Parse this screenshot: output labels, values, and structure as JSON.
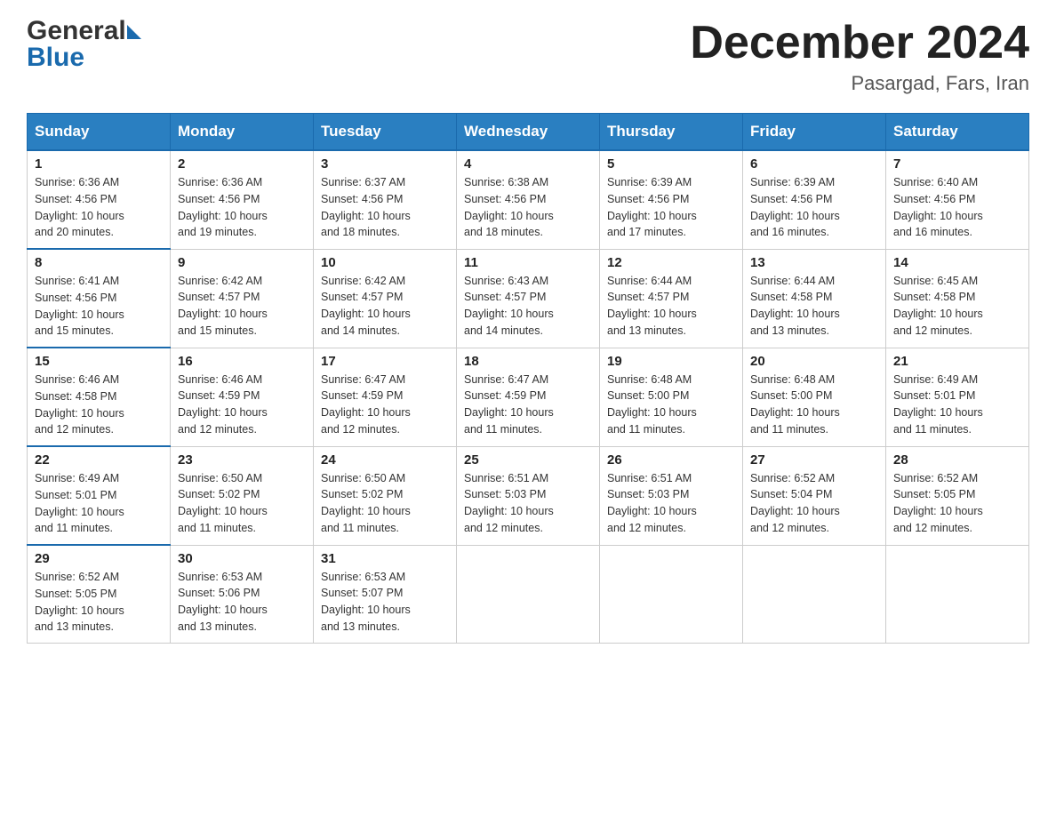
{
  "header": {
    "logo": {
      "general": "General",
      "blue": "Blue"
    },
    "title": "December 2024",
    "location": "Pasargad, Fars, Iran"
  },
  "days_of_week": [
    "Sunday",
    "Monday",
    "Tuesday",
    "Wednesday",
    "Thursday",
    "Friday",
    "Saturday"
  ],
  "weeks": [
    [
      {
        "day": "1",
        "sunrise": "6:36 AM",
        "sunset": "4:56 PM",
        "daylight": "10 hours and 20 minutes."
      },
      {
        "day": "2",
        "sunrise": "6:36 AM",
        "sunset": "4:56 PM",
        "daylight": "10 hours and 19 minutes."
      },
      {
        "day": "3",
        "sunrise": "6:37 AM",
        "sunset": "4:56 PM",
        "daylight": "10 hours and 18 minutes."
      },
      {
        "day": "4",
        "sunrise": "6:38 AM",
        "sunset": "4:56 PM",
        "daylight": "10 hours and 18 minutes."
      },
      {
        "day": "5",
        "sunrise": "6:39 AM",
        "sunset": "4:56 PM",
        "daylight": "10 hours and 17 minutes."
      },
      {
        "day": "6",
        "sunrise": "6:39 AM",
        "sunset": "4:56 PM",
        "daylight": "10 hours and 16 minutes."
      },
      {
        "day": "7",
        "sunrise": "6:40 AM",
        "sunset": "4:56 PM",
        "daylight": "10 hours and 16 minutes."
      }
    ],
    [
      {
        "day": "8",
        "sunrise": "6:41 AM",
        "sunset": "4:56 PM",
        "daylight": "10 hours and 15 minutes."
      },
      {
        "day": "9",
        "sunrise": "6:42 AM",
        "sunset": "4:57 PM",
        "daylight": "10 hours and 15 minutes."
      },
      {
        "day": "10",
        "sunrise": "6:42 AM",
        "sunset": "4:57 PM",
        "daylight": "10 hours and 14 minutes."
      },
      {
        "day": "11",
        "sunrise": "6:43 AM",
        "sunset": "4:57 PM",
        "daylight": "10 hours and 14 minutes."
      },
      {
        "day": "12",
        "sunrise": "6:44 AM",
        "sunset": "4:57 PM",
        "daylight": "10 hours and 13 minutes."
      },
      {
        "day": "13",
        "sunrise": "6:44 AM",
        "sunset": "4:58 PM",
        "daylight": "10 hours and 13 minutes."
      },
      {
        "day": "14",
        "sunrise": "6:45 AM",
        "sunset": "4:58 PM",
        "daylight": "10 hours and 12 minutes."
      }
    ],
    [
      {
        "day": "15",
        "sunrise": "6:46 AM",
        "sunset": "4:58 PM",
        "daylight": "10 hours and 12 minutes."
      },
      {
        "day": "16",
        "sunrise": "6:46 AM",
        "sunset": "4:59 PM",
        "daylight": "10 hours and 12 minutes."
      },
      {
        "day": "17",
        "sunrise": "6:47 AM",
        "sunset": "4:59 PM",
        "daylight": "10 hours and 12 minutes."
      },
      {
        "day": "18",
        "sunrise": "6:47 AM",
        "sunset": "4:59 PM",
        "daylight": "10 hours and 11 minutes."
      },
      {
        "day": "19",
        "sunrise": "6:48 AM",
        "sunset": "5:00 PM",
        "daylight": "10 hours and 11 minutes."
      },
      {
        "day": "20",
        "sunrise": "6:48 AM",
        "sunset": "5:00 PM",
        "daylight": "10 hours and 11 minutes."
      },
      {
        "day": "21",
        "sunrise": "6:49 AM",
        "sunset": "5:01 PM",
        "daylight": "10 hours and 11 minutes."
      }
    ],
    [
      {
        "day": "22",
        "sunrise": "6:49 AM",
        "sunset": "5:01 PM",
        "daylight": "10 hours and 11 minutes."
      },
      {
        "day": "23",
        "sunrise": "6:50 AM",
        "sunset": "5:02 PM",
        "daylight": "10 hours and 11 minutes."
      },
      {
        "day": "24",
        "sunrise": "6:50 AM",
        "sunset": "5:02 PM",
        "daylight": "10 hours and 11 minutes."
      },
      {
        "day": "25",
        "sunrise": "6:51 AM",
        "sunset": "5:03 PM",
        "daylight": "10 hours and 12 minutes."
      },
      {
        "day": "26",
        "sunrise": "6:51 AM",
        "sunset": "5:03 PM",
        "daylight": "10 hours and 12 minutes."
      },
      {
        "day": "27",
        "sunrise": "6:52 AM",
        "sunset": "5:04 PM",
        "daylight": "10 hours and 12 minutes."
      },
      {
        "day": "28",
        "sunrise": "6:52 AM",
        "sunset": "5:05 PM",
        "daylight": "10 hours and 12 minutes."
      }
    ],
    [
      {
        "day": "29",
        "sunrise": "6:52 AM",
        "sunset": "5:05 PM",
        "daylight": "10 hours and 13 minutes."
      },
      {
        "day": "30",
        "sunrise": "6:53 AM",
        "sunset": "5:06 PM",
        "daylight": "10 hours and 13 minutes."
      },
      {
        "day": "31",
        "sunrise": "6:53 AM",
        "sunset": "5:07 PM",
        "daylight": "10 hours and 13 minutes."
      },
      null,
      null,
      null,
      null
    ]
  ],
  "labels": {
    "sunrise": "Sunrise:",
    "sunset": "Sunset:",
    "daylight": "Daylight:"
  }
}
